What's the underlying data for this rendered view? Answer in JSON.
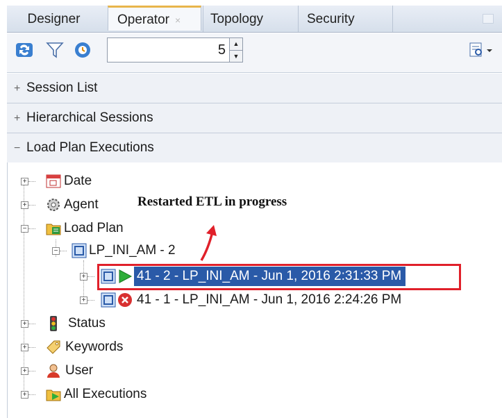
{
  "tabs": [
    {
      "label": "Designer"
    },
    {
      "label": "Operator",
      "close": "×"
    },
    {
      "label": "Topology"
    },
    {
      "label": "Security"
    }
  ],
  "toolbar": {
    "spinner_value": "5",
    "icons": [
      "refresh-icon",
      "filter-icon",
      "auto-refresh-icon",
      "view-menu-icon"
    ]
  },
  "sections": {
    "session_list": {
      "label": "Session List",
      "toggle": "+"
    },
    "hier_sessions": {
      "label": "Hierarchical Sessions",
      "toggle": "+"
    },
    "load_plan_exec": {
      "label": "Load Plan Executions",
      "toggle": "−"
    }
  },
  "tree": {
    "date": "Date",
    "agent": "Agent",
    "load_plan": "Load Plan",
    "lp": "LP_INI_AM - 2",
    "exec1": "41 - 2 - LP_INI_AM - Jun 1, 2016 2:31:33 PM",
    "exec2": "41 - 1 - LP_INI_AM - Jun 1, 2016 2:24:26 PM",
    "status": "Status",
    "keywords": "Keywords",
    "user": "User",
    "all_exec": "All Executions"
  },
  "annotation": "Restarted ETL in progress",
  "colors": {
    "selection": "#2a5aa8",
    "highlight_border": "#e0202a",
    "tab_accent": "#e8b54a"
  }
}
